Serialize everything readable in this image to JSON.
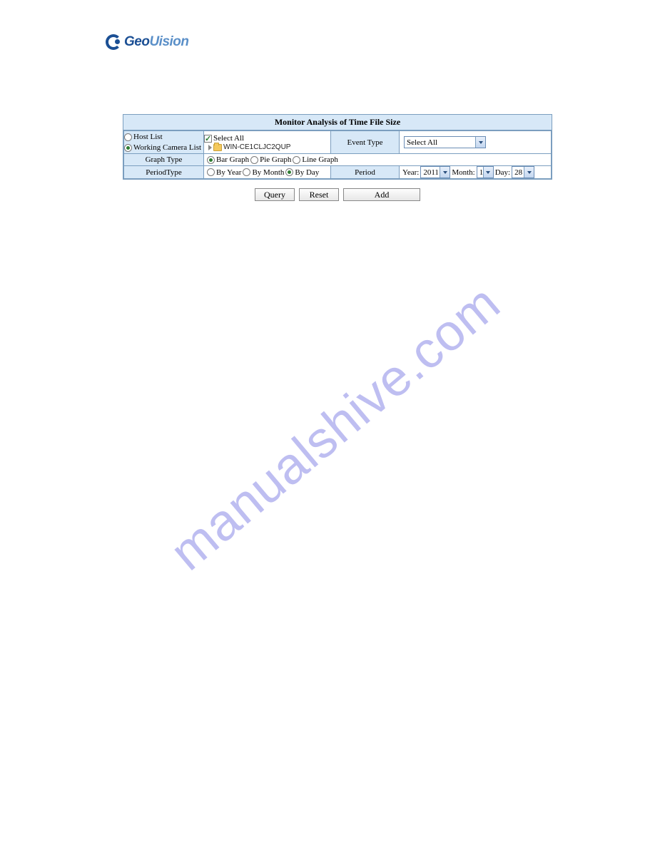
{
  "logo": {
    "text_geo": "Geo",
    "text_vision": "Uision"
  },
  "panel": {
    "title": "Monitor Analysis of Time File Size",
    "list": {
      "host_label": "Host List",
      "working_label": "Working Camera List",
      "host_checked": false,
      "working_checked": true
    },
    "tree": {
      "select_all_label": "Select All",
      "select_all_checked": true,
      "node_label": "WIN-CE1CLJC2QUP"
    },
    "event_type": {
      "label": "Event Type",
      "value": "Select All"
    },
    "graph_type": {
      "label": "Graph Type",
      "options": [
        "Bar Graph",
        "Pie Graph",
        "Line Graph"
      ],
      "selected": "Bar Graph"
    },
    "period_type": {
      "label": "PeriodType",
      "options": [
        "By Year",
        "By Month",
        "By Day"
      ],
      "selected": "By Day"
    },
    "period": {
      "label": "Period",
      "year_label": "Year:",
      "year_value": "2011",
      "month_label": "Month:",
      "month_value": "1",
      "day_label": "Day:",
      "day_value": "28"
    }
  },
  "buttons": {
    "query": "Query",
    "reset": "Reset",
    "add": "Add"
  },
  "watermark": "manualshive.com"
}
